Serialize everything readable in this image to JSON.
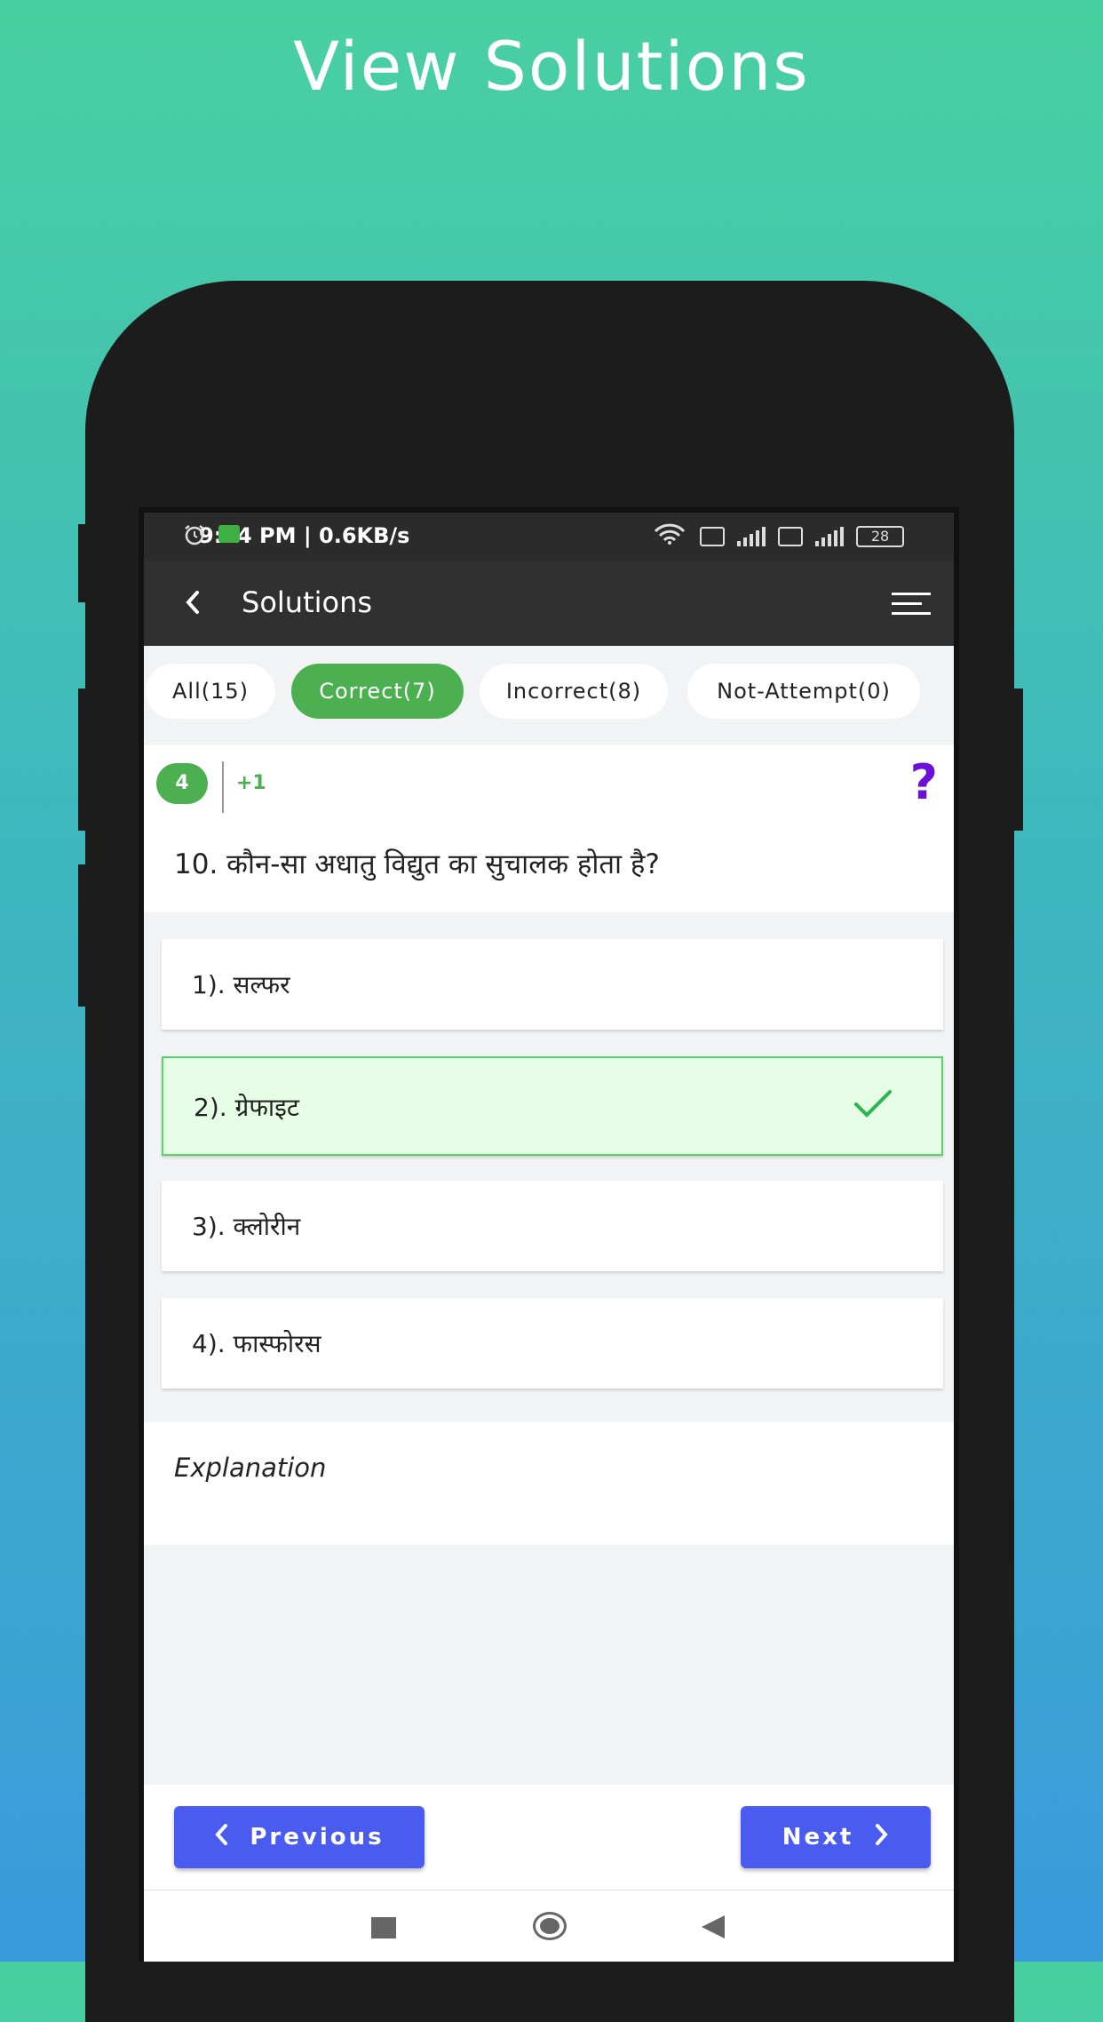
{
  "promo": {
    "title": "View Solutions"
  },
  "statusbar": {
    "time": "9:44 PM | 0.6KB/s",
    "battery": "28"
  },
  "appbar": {
    "title": "Solutions"
  },
  "filters": [
    {
      "label": "All(15)"
    },
    {
      "label": "Correct(7)"
    },
    {
      "label": "Incorrect(8)"
    },
    {
      "label": "Not-Attempt(0)"
    }
  ],
  "question": {
    "badge": "4",
    "marks": "+1",
    "help": "?",
    "text": "10. कौन-सा अधातु विद्युत का सुचालक होता है?"
  },
  "options": [
    {
      "label": "1).  सल्फर"
    },
    {
      "label": "2).  ग्रेफाइट"
    },
    {
      "label": "3).  क्लोरीन"
    },
    {
      "label": "4). फास्फोरस"
    }
  ],
  "explanation": {
    "label": "Explanation"
  },
  "nav": {
    "previous": "Previous",
    "next": "Next"
  },
  "colors": {
    "accent": "#4caf50",
    "primary_button": "#4a5cf0",
    "help": "#6a11d6"
  }
}
